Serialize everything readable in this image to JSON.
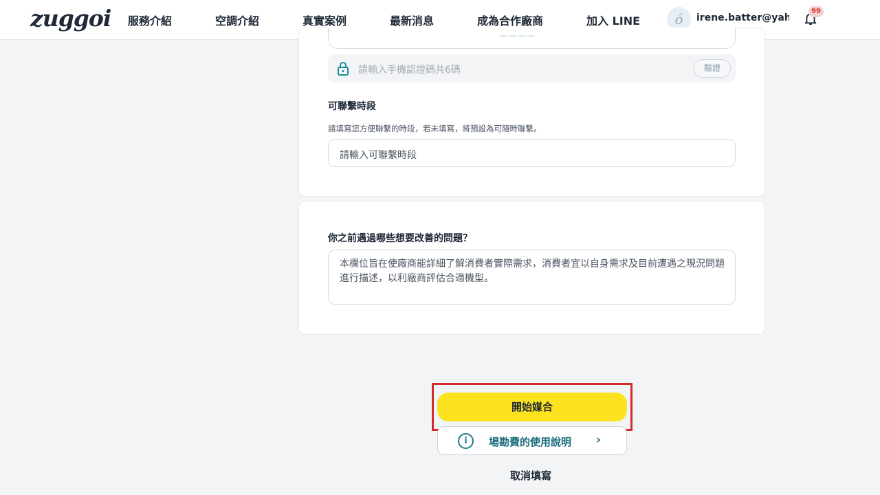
{
  "header": {
    "logo": "zuggoi",
    "nav": [
      "服務介紹",
      "空調介紹",
      "真實案例",
      "最新消息",
      "成為合作廠商",
      "加入 LINE"
    ],
    "user_email": "irene.batter@yah⋯",
    "notification_count": "99"
  },
  "form": {
    "verify_placeholder": "請輸入手機認證碼共6碼",
    "verify_button": "驗證",
    "contact_time_label": "可聯繫時段",
    "contact_time_hint": "請填寫您方便聯繫的時段，若未填寫，將預設為可隨時聯繫。",
    "contact_time_placeholder": "請輸入可聯繫時段",
    "problem_label": "你之前遇過哪些想要改善的問題？",
    "problem_placeholder": "本欄位旨在使廠商能詳細了解消費者實際需求，消費者宜以自身需求及目前遭遇之現況問題進行描述，以利廠商評估合適機型。"
  },
  "actions": {
    "start_matching": "開始媒合",
    "fee_info": "場勘費的使用說明",
    "cancel": "取消填寫"
  },
  "colors": {
    "accent_yellow": "#fde31f",
    "teal": "#1a6b7c",
    "highlight_red": "#d42a2a"
  }
}
